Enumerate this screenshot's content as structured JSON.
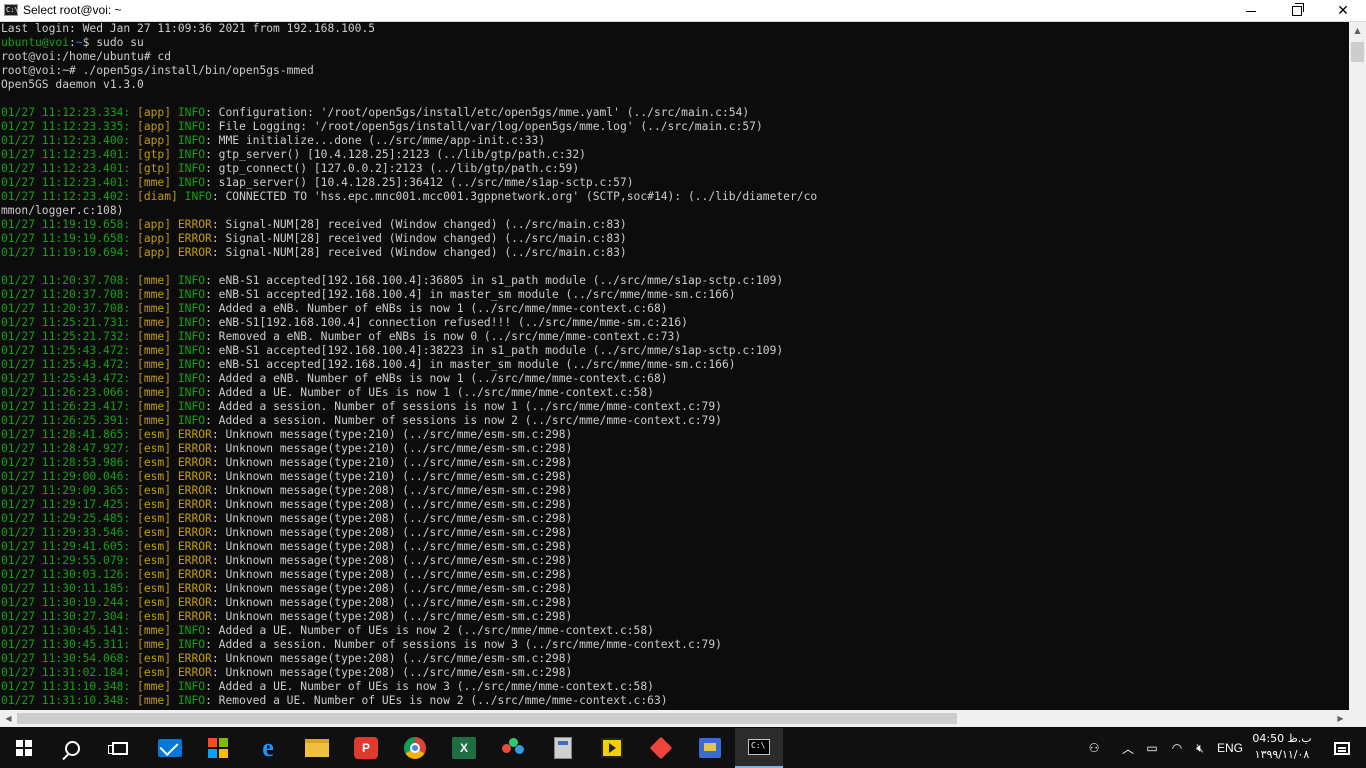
{
  "window": {
    "title": "Select root@voi: ~",
    "app_icon_text": "C:\\"
  },
  "console": {
    "lines": [
      {
        "parts": [
          {
            "t": "Last login: Wed Jan 27 11:09:36 2021 from 192.168.100.5",
            "c": "gray"
          }
        ]
      },
      {
        "parts": [
          {
            "t": "ubuntu@voi",
            "c": "green"
          },
          {
            "t": ":",
            "c": "gray"
          },
          {
            "t": "~",
            "c": "blue"
          },
          {
            "t": "$ sudo su",
            "c": "gray"
          }
        ]
      },
      {
        "parts": [
          {
            "t": "root@voi:/home/ubuntu# cd",
            "c": "gray"
          }
        ]
      },
      {
        "parts": [
          {
            "t": "root@voi:~# ./open5gs/install/bin/open5gs-mmed",
            "c": "gray"
          }
        ]
      },
      {
        "parts": [
          {
            "t": "Open5GS daemon v1.3.0",
            "c": "gray"
          }
        ]
      },
      {
        "parts": [
          {
            "t": "",
            "c": "gray"
          }
        ]
      },
      {
        "parts": [
          {
            "t": "01/27 11:12:23.334: ",
            "c": "green"
          },
          {
            "t": "[app] ",
            "c": "yellow"
          },
          {
            "t": "INFO",
            "c": "green"
          },
          {
            "t": ": Configuration: '/root/open5gs/install/etc/open5gs/mme.yaml' (../src/main.c:54)",
            "c": "gray"
          }
        ]
      },
      {
        "parts": [
          {
            "t": "01/27 11:12:23.335: ",
            "c": "green"
          },
          {
            "t": "[app] ",
            "c": "yellow"
          },
          {
            "t": "INFO",
            "c": "green"
          },
          {
            "t": ": File Logging: '/root/open5gs/install/var/log/open5gs/mme.log' (../src/main.c:57)",
            "c": "gray"
          }
        ]
      },
      {
        "parts": [
          {
            "t": "01/27 11:12:23.400: ",
            "c": "green"
          },
          {
            "t": "[app] ",
            "c": "yellow"
          },
          {
            "t": "INFO",
            "c": "green"
          },
          {
            "t": ": MME initialize...done (../src/mme/app-init.c:33)",
            "c": "gray"
          }
        ]
      },
      {
        "parts": [
          {
            "t": "01/27 11:12:23.401: ",
            "c": "green"
          },
          {
            "t": "[gtp] ",
            "c": "yellow"
          },
          {
            "t": "INFO",
            "c": "green"
          },
          {
            "t": ": gtp_server() [10.4.128.25]:2123 (../lib/gtp/path.c:32)",
            "c": "gray"
          }
        ]
      },
      {
        "parts": [
          {
            "t": "01/27 11:12:23.401: ",
            "c": "green"
          },
          {
            "t": "[gtp] ",
            "c": "yellow"
          },
          {
            "t": "INFO",
            "c": "green"
          },
          {
            "t": ": gtp_connect() [127.0.0.2]:2123 (../lib/gtp/path.c:59)",
            "c": "gray"
          }
        ]
      },
      {
        "parts": [
          {
            "t": "01/27 11:12:23.401: ",
            "c": "green"
          },
          {
            "t": "[mme] ",
            "c": "yellow"
          },
          {
            "t": "INFO",
            "c": "green"
          },
          {
            "t": ": s1ap_server() [10.4.128.25]:36412 (../src/mme/s1ap-sctp.c:57)",
            "c": "gray"
          }
        ]
      },
      {
        "parts": [
          {
            "t": "01/27 11:12:23.402: ",
            "c": "green"
          },
          {
            "t": "[diam] ",
            "c": "yellow"
          },
          {
            "t": "INFO",
            "c": "green"
          },
          {
            "t": ": CONNECTED TO 'hss.epc.mnc001.mcc001.3gppnetwork.org' (SCTP,soc#14): (../lib/diameter/co",
            "c": "gray"
          }
        ]
      },
      {
        "parts": [
          {
            "t": "mmon/logger.c:108)",
            "c": "gray"
          }
        ]
      },
      {
        "parts": [
          {
            "t": "01/27 11:19:19.658: ",
            "c": "green"
          },
          {
            "t": "[app] ",
            "c": "yellow"
          },
          {
            "t": "ERROR",
            "c": "yellow"
          },
          {
            "t": ": Signal-NUM[28] received (Window changed) (../src/main.c:83)",
            "c": "gray"
          }
        ]
      },
      {
        "parts": [
          {
            "t": "01/27 11:19:19.658: ",
            "c": "green"
          },
          {
            "t": "[app] ",
            "c": "yellow"
          },
          {
            "t": "ERROR",
            "c": "yellow"
          },
          {
            "t": ": Signal-NUM[28] received (Window changed) (../src/main.c:83)",
            "c": "gray"
          }
        ]
      },
      {
        "parts": [
          {
            "t": "01/27 11:19:19.694: ",
            "c": "green"
          },
          {
            "t": "[app] ",
            "c": "yellow"
          },
          {
            "t": "ERROR",
            "c": "yellow"
          },
          {
            "t": ": Signal-NUM[28] received (Window changed) (../src/main.c:83)",
            "c": "gray"
          }
        ]
      },
      {
        "parts": [
          {
            "t": "",
            "c": "gray"
          }
        ]
      },
      {
        "parts": [
          {
            "t": "01/27 11:20:37.708: ",
            "c": "green"
          },
          {
            "t": "[mme] ",
            "c": "yellow"
          },
          {
            "t": "INFO",
            "c": "green"
          },
          {
            "t": ": eNB-S1 accepted[192.168.100.4]:36805 in s1_path module (../src/mme/s1ap-sctp.c:109)",
            "c": "gray"
          }
        ]
      },
      {
        "parts": [
          {
            "t": "01/27 11:20:37.708: ",
            "c": "green"
          },
          {
            "t": "[mme] ",
            "c": "yellow"
          },
          {
            "t": "INFO",
            "c": "green"
          },
          {
            "t": ": eNB-S1 accepted[192.168.100.4] in master_sm module (../src/mme/mme-sm.c:166)",
            "c": "gray"
          }
        ]
      },
      {
        "parts": [
          {
            "t": "01/27 11:20:37.708: ",
            "c": "green"
          },
          {
            "t": "[mme] ",
            "c": "yellow"
          },
          {
            "t": "INFO",
            "c": "green"
          },
          {
            "t": ": Added a eNB. Number of eNBs is now 1 (../src/mme/mme-context.c:68)",
            "c": "gray"
          }
        ]
      },
      {
        "parts": [
          {
            "t": "01/27 11:25:21.731: ",
            "c": "green"
          },
          {
            "t": "[mme] ",
            "c": "yellow"
          },
          {
            "t": "INFO",
            "c": "green"
          },
          {
            "t": ": eNB-S1[192.168.100.4] connection refused!!! (../src/mme/mme-sm.c:216)",
            "c": "gray"
          }
        ]
      },
      {
        "parts": [
          {
            "t": "01/27 11:25:21.732: ",
            "c": "green"
          },
          {
            "t": "[mme] ",
            "c": "yellow"
          },
          {
            "t": "INFO",
            "c": "green"
          },
          {
            "t": ": Removed a eNB. Number of eNBs is now 0 (../src/mme/mme-context.c:73)",
            "c": "gray"
          }
        ]
      },
      {
        "parts": [
          {
            "t": "01/27 11:25:43.472: ",
            "c": "green"
          },
          {
            "t": "[mme] ",
            "c": "yellow"
          },
          {
            "t": "INFO",
            "c": "green"
          },
          {
            "t": ": eNB-S1 accepted[192.168.100.4]:38223 in s1_path module (../src/mme/s1ap-sctp.c:109)",
            "c": "gray"
          }
        ]
      },
      {
        "parts": [
          {
            "t": "01/27 11:25:43.472: ",
            "c": "green"
          },
          {
            "t": "[mme] ",
            "c": "yellow"
          },
          {
            "t": "INFO",
            "c": "green"
          },
          {
            "t": ": eNB-S1 accepted[192.168.100.4] in master_sm module (../src/mme/mme-sm.c:166)",
            "c": "gray"
          }
        ]
      },
      {
        "parts": [
          {
            "t": "01/27 11:25:43.472: ",
            "c": "green"
          },
          {
            "t": "[mme] ",
            "c": "yellow"
          },
          {
            "t": "INFO",
            "c": "green"
          },
          {
            "t": ": Added a eNB. Number of eNBs is now 1 (../src/mme/mme-context.c:68)",
            "c": "gray"
          }
        ]
      },
      {
        "parts": [
          {
            "t": "01/27 11:26:23.066: ",
            "c": "green"
          },
          {
            "t": "[mme] ",
            "c": "yellow"
          },
          {
            "t": "INFO",
            "c": "green"
          },
          {
            "t": ": Added a UE. Number of UEs is now 1 (../src/mme/mme-context.c:58)",
            "c": "gray"
          }
        ]
      },
      {
        "parts": [
          {
            "t": "01/27 11:26:23.417: ",
            "c": "green"
          },
          {
            "t": "[mme] ",
            "c": "yellow"
          },
          {
            "t": "INFO",
            "c": "green"
          },
          {
            "t": ": Added a session. Number of sessions is now 1 (../src/mme/mme-context.c:79)",
            "c": "gray"
          }
        ]
      },
      {
        "parts": [
          {
            "t": "01/27 11:26:25.391: ",
            "c": "green"
          },
          {
            "t": "[mme] ",
            "c": "yellow"
          },
          {
            "t": "INFO",
            "c": "green"
          },
          {
            "t": ": Added a session. Number of sessions is now 2 (../src/mme/mme-context.c:79)",
            "c": "gray"
          }
        ]
      },
      {
        "parts": [
          {
            "t": "01/27 11:28:41.865: ",
            "c": "green"
          },
          {
            "t": "[esm] ",
            "c": "yellow"
          },
          {
            "t": "ERROR",
            "c": "yellow"
          },
          {
            "t": ": Unknown message(type:210) (../src/mme/esm-sm.c:298)",
            "c": "gray"
          }
        ]
      },
      {
        "parts": [
          {
            "t": "01/27 11:28:47.927: ",
            "c": "green"
          },
          {
            "t": "[esm] ",
            "c": "yellow"
          },
          {
            "t": "ERROR",
            "c": "yellow"
          },
          {
            "t": ": Unknown message(type:210) (../src/mme/esm-sm.c:298)",
            "c": "gray"
          }
        ]
      },
      {
        "parts": [
          {
            "t": "01/27 11:28:53.986: ",
            "c": "green"
          },
          {
            "t": "[esm] ",
            "c": "yellow"
          },
          {
            "t": "ERROR",
            "c": "yellow"
          },
          {
            "t": ": Unknown message(type:210) (../src/mme/esm-sm.c:298)",
            "c": "gray"
          }
        ]
      },
      {
        "parts": [
          {
            "t": "01/27 11:29:00.046: ",
            "c": "green"
          },
          {
            "t": "[esm] ",
            "c": "yellow"
          },
          {
            "t": "ERROR",
            "c": "yellow"
          },
          {
            "t": ": Unknown message(type:210) (../src/mme/esm-sm.c:298)",
            "c": "gray"
          }
        ]
      },
      {
        "parts": [
          {
            "t": "01/27 11:29:09.365: ",
            "c": "green"
          },
          {
            "t": "[esm] ",
            "c": "yellow"
          },
          {
            "t": "ERROR",
            "c": "yellow"
          },
          {
            "t": ": Unknown message(type:208) (../src/mme/esm-sm.c:298)",
            "c": "gray"
          }
        ]
      },
      {
        "parts": [
          {
            "t": "01/27 11:29:17.425: ",
            "c": "green"
          },
          {
            "t": "[esm] ",
            "c": "yellow"
          },
          {
            "t": "ERROR",
            "c": "yellow"
          },
          {
            "t": ": Unknown message(type:208) (../src/mme/esm-sm.c:298)",
            "c": "gray"
          }
        ]
      },
      {
        "parts": [
          {
            "t": "01/27 11:29:25.485: ",
            "c": "green"
          },
          {
            "t": "[esm] ",
            "c": "yellow"
          },
          {
            "t": "ERROR",
            "c": "yellow"
          },
          {
            "t": ": Unknown message(type:208) (../src/mme/esm-sm.c:298)",
            "c": "gray"
          }
        ]
      },
      {
        "parts": [
          {
            "t": "01/27 11:29:33.546: ",
            "c": "green"
          },
          {
            "t": "[esm] ",
            "c": "yellow"
          },
          {
            "t": "ERROR",
            "c": "yellow"
          },
          {
            "t": ": Unknown message(type:208) (../src/mme/esm-sm.c:298)",
            "c": "gray"
          }
        ]
      },
      {
        "parts": [
          {
            "t": "01/27 11:29:41.605: ",
            "c": "green"
          },
          {
            "t": "[esm] ",
            "c": "yellow"
          },
          {
            "t": "ERROR",
            "c": "yellow"
          },
          {
            "t": ": Unknown message(type:208) (../src/mme/esm-sm.c:298)",
            "c": "gray"
          }
        ]
      },
      {
        "parts": [
          {
            "t": "01/27 11:29:55.079: ",
            "c": "green"
          },
          {
            "t": "[esm] ",
            "c": "yellow"
          },
          {
            "t": "ERROR",
            "c": "yellow"
          },
          {
            "t": ": Unknown message(type:208) (../src/mme/esm-sm.c:298)",
            "c": "gray"
          }
        ]
      },
      {
        "parts": [
          {
            "t": "01/27 11:30:03.126: ",
            "c": "green"
          },
          {
            "t": "[esm] ",
            "c": "yellow"
          },
          {
            "t": "ERROR",
            "c": "yellow"
          },
          {
            "t": ": Unknown message(type:208) (../src/mme/esm-sm.c:298)",
            "c": "gray"
          }
        ]
      },
      {
        "parts": [
          {
            "t": "01/27 11:30:11.185: ",
            "c": "green"
          },
          {
            "t": "[esm] ",
            "c": "yellow"
          },
          {
            "t": "ERROR",
            "c": "yellow"
          },
          {
            "t": ": Unknown message(type:208) (../src/mme/esm-sm.c:298)",
            "c": "gray"
          }
        ]
      },
      {
        "parts": [
          {
            "t": "01/27 11:30:19.244: ",
            "c": "green"
          },
          {
            "t": "[esm] ",
            "c": "yellow"
          },
          {
            "t": "ERROR",
            "c": "yellow"
          },
          {
            "t": ": Unknown message(type:208) (../src/mme/esm-sm.c:298)",
            "c": "gray"
          }
        ]
      },
      {
        "parts": [
          {
            "t": "01/27 11:30:27.304: ",
            "c": "green"
          },
          {
            "t": "[esm] ",
            "c": "yellow"
          },
          {
            "t": "ERROR",
            "c": "yellow"
          },
          {
            "t": ": Unknown message(type:208) (../src/mme/esm-sm.c:298)",
            "c": "gray"
          }
        ]
      },
      {
        "parts": [
          {
            "t": "01/27 11:30:45.141: ",
            "c": "green"
          },
          {
            "t": "[mme] ",
            "c": "yellow"
          },
          {
            "t": "INFO",
            "c": "green"
          },
          {
            "t": ": Added a UE. Number of UEs is now 2 (../src/mme/mme-context.c:58)",
            "c": "gray"
          }
        ]
      },
      {
        "parts": [
          {
            "t": "01/27 11:30:45.311: ",
            "c": "green"
          },
          {
            "t": "[mme] ",
            "c": "yellow"
          },
          {
            "t": "INFO",
            "c": "green"
          },
          {
            "t": ": Added a session. Number of sessions is now 3 (../src/mme/mme-context.c:79)",
            "c": "gray"
          }
        ]
      },
      {
        "parts": [
          {
            "t": "01/27 11:30:54.068: ",
            "c": "green"
          },
          {
            "t": "[esm] ",
            "c": "yellow"
          },
          {
            "t": "ERROR",
            "c": "yellow"
          },
          {
            "t": ": Unknown message(type:208) (../src/mme/esm-sm.c:298)",
            "c": "gray"
          }
        ]
      },
      {
        "parts": [
          {
            "t": "01/27 11:31:02.184: ",
            "c": "green"
          },
          {
            "t": "[esm] ",
            "c": "yellow"
          },
          {
            "t": "ERROR",
            "c": "yellow"
          },
          {
            "t": ": Unknown message(type:208) (../src/mme/esm-sm.c:298)",
            "c": "gray"
          }
        ]
      },
      {
        "parts": [
          {
            "t": "01/27 11:31:10.348: ",
            "c": "green"
          },
          {
            "t": "[mme] ",
            "c": "yellow"
          },
          {
            "t": "INFO",
            "c": "green"
          },
          {
            "t": ": Added a UE. Number of UEs is now 3 (../src/mme/mme-context.c:58)",
            "c": "gray"
          }
        ]
      },
      {
        "parts": [
          {
            "t": "01/27 11:31:10.348: ",
            "c": "green"
          },
          {
            "t": "[mme] ",
            "c": "yellow"
          },
          {
            "t": "INFO",
            "c": "green"
          },
          {
            "t": ": Removed a UE. Number of UEs is now 2 (../src/mme/mme-context.c:63)",
            "c": "gray"
          }
        ]
      }
    ]
  },
  "taskbar": {
    "psiphon_letter": "P",
    "excel_letter": "X",
    "language": "ENG",
    "clock_time": "04:50 ب.ظ",
    "clock_date": "۱۳۹۹/۱۱/۰۸",
    "icons": [
      "windows-start-icon",
      "search-icon",
      "task-view-icon",
      "mail-icon",
      "store-icon",
      "edge-icon",
      "file-explorer-icon",
      "psiphon-icon",
      "chrome-icon",
      "excel-icon",
      "colorful-dots-icon",
      "calculator-icon",
      "media-player-icon",
      "anydesk-icon",
      "network-app-icon",
      "command-prompt-icon"
    ]
  },
  "colors": {
    "green": "#13a10e",
    "blue": "#3b78ff",
    "yellow": "#c19c00",
    "gray": "#cccccc",
    "taskbar": "#101010",
    "console_bg": "#0c0c0c"
  }
}
